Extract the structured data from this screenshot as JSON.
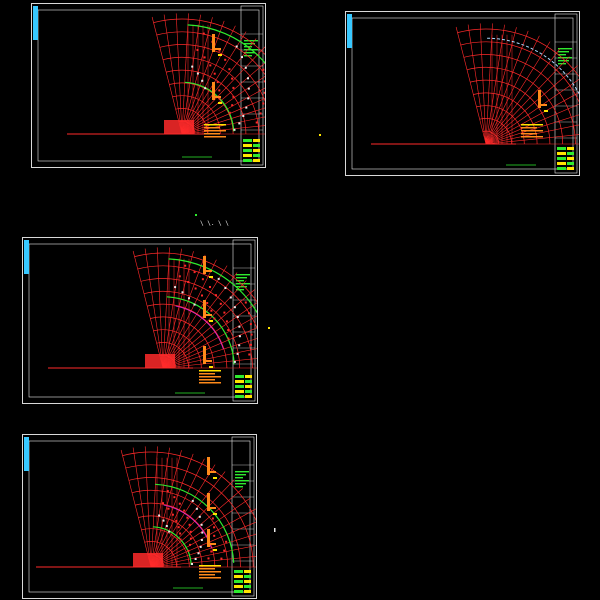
{
  "canvas": {
    "background": "#000000"
  },
  "colors": {
    "sheet_border": "#d8d8d8",
    "red": "#ff2a2a",
    "green": "#2eea2e",
    "yellow": "#ffe400",
    "orange": "#ff8a1a",
    "cyan": "#38c8ff",
    "magenta": "#e02ad8",
    "white": "#e8e8e8"
  },
  "sheets": [
    {
      "id": "sheet-1",
      "title_block_icon": "cad-title-block",
      "plan_icon": "quarter-circle-floor-plan"
    },
    {
      "id": "sheet-2",
      "title_block_icon": "cad-title-block",
      "plan_icon": "quarter-circle-floor-plan"
    },
    {
      "id": "sheet-3",
      "title_block_icon": "cad-title-block",
      "plan_icon": "quarter-circle-floor-plan"
    },
    {
      "id": "sheet-4",
      "title_block_icon": "cad-title-block",
      "plan_icon": "quarter-circle-floor-plan"
    }
  ],
  "stray_labels": {
    "middle_note": "\\ \\. \\ \\"
  }
}
